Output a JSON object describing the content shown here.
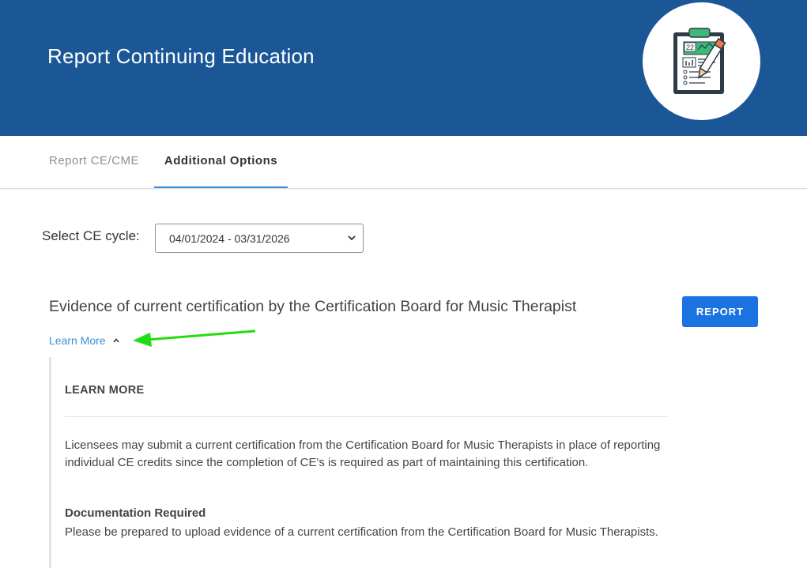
{
  "header": {
    "title": "Report Continuing Education",
    "illustration_icon": "clipboard-chart-pencil-icon",
    "illustration_number": "22",
    "colors": {
      "banner": "#1b5796",
      "accent": "#1a73e0"
    }
  },
  "tabs": [
    {
      "label": "Report CE/CME",
      "active": false
    },
    {
      "label": "Additional Options",
      "active": true
    }
  ],
  "cycle": {
    "label": "Select CE cycle:",
    "selected": "04/01/2024 - 03/31/2026"
  },
  "item": {
    "title": "Evidence of current certification by the Certification Board for Music Therapist",
    "report_label": "REPORT",
    "learn_more_label": "Learn More",
    "learn_more_icon": "chevron-up-icon"
  },
  "annotation": {
    "arrow_icon": "green-arrow-icon",
    "color": "#22dd11"
  },
  "learn_panel": {
    "heading": "LEARN MORE",
    "body": "Licensees may submit a current certification from the Certification Board for Music Therapists in place of reporting individual CE credits since the completion of CE's is required as part of maintaining this certification.",
    "doc_title": "Documentation Required",
    "doc_body": "Please be prepared to upload evidence of a current certification from the Certification Board for Music Therapists."
  }
}
